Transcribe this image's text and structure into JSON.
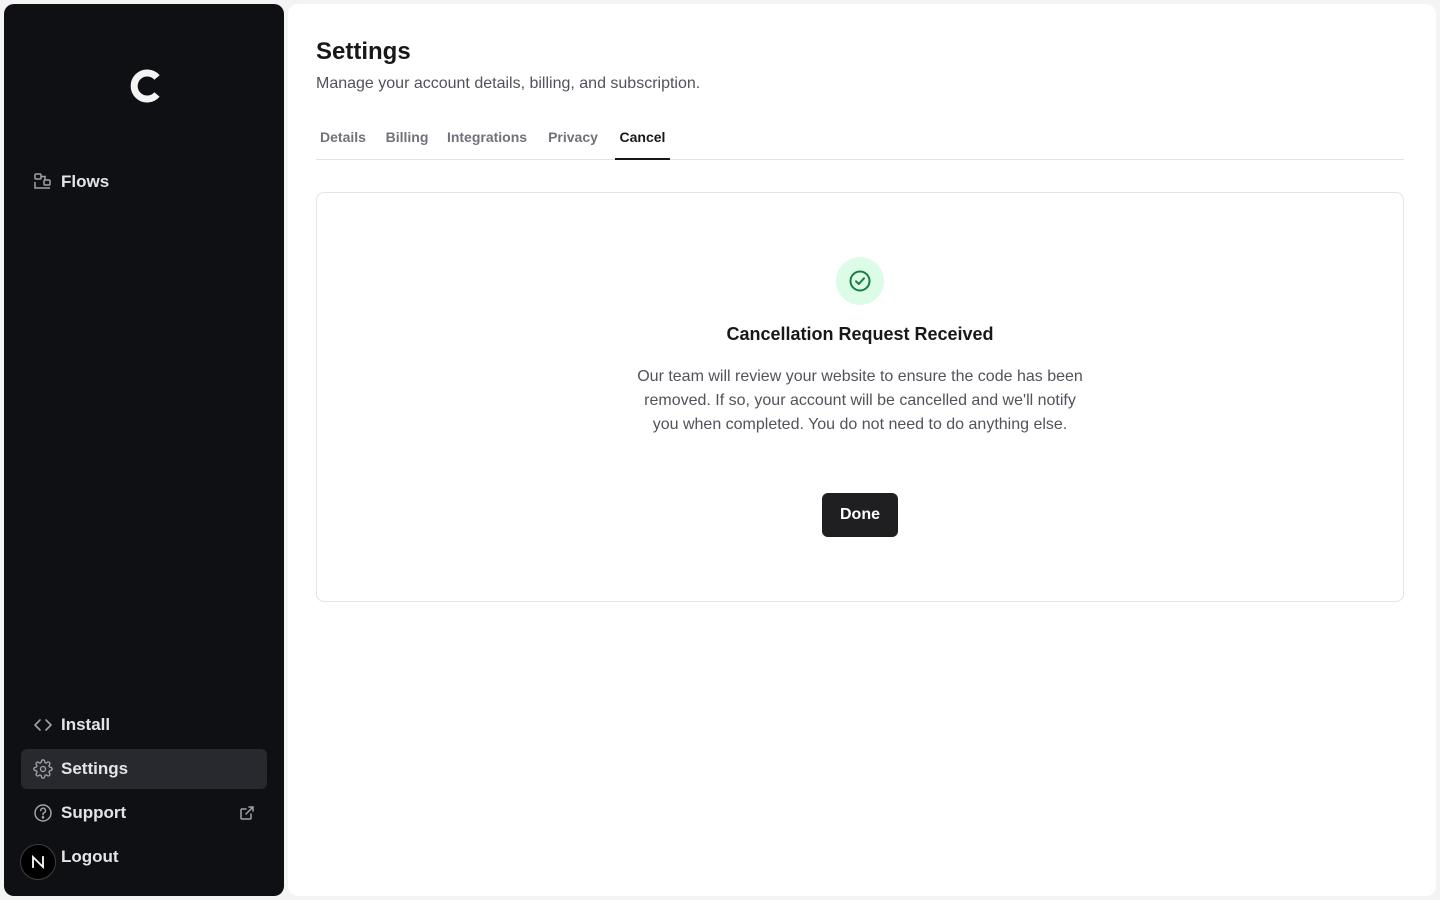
{
  "sidebar": {
    "logo_letter": "C",
    "nav_top": [
      {
        "label": "Flows",
        "icon": "flows-icon"
      }
    ],
    "nav_bottom": [
      {
        "label": "Install",
        "icon": "code-icon"
      },
      {
        "label": "Settings",
        "icon": "gear-icon"
      },
      {
        "label": "Support",
        "icon": "help-circle-icon",
        "external": true
      },
      {
        "label": "Logout",
        "icon": "avatar"
      }
    ],
    "active_item": "Settings",
    "avatar_letter": "N"
  },
  "main": {
    "title": "Settings",
    "subtitle": "Manage your account details, billing, and subscription.",
    "tabs": [
      {
        "label": "Details"
      },
      {
        "label": "Billing"
      },
      {
        "label": "Integrations"
      },
      {
        "label": "Privacy"
      },
      {
        "label": "Cancel"
      }
    ],
    "active_tab": "Cancel",
    "card": {
      "icon": "check-circle-icon",
      "title": "Cancellation Request Received",
      "body": "Our team will review your website to ensure the code has been removed. If so, your account will be cancelled and we'll notify you when completed. You do not need to do anything else.",
      "button_label": "Done"
    }
  },
  "colors": {
    "sidebar_bg": "#0e1014",
    "active_nav_bg": "#27292f",
    "success_green": "#15803d",
    "success_bg": "#dcfce7",
    "primary_button": "#1f1f22"
  }
}
